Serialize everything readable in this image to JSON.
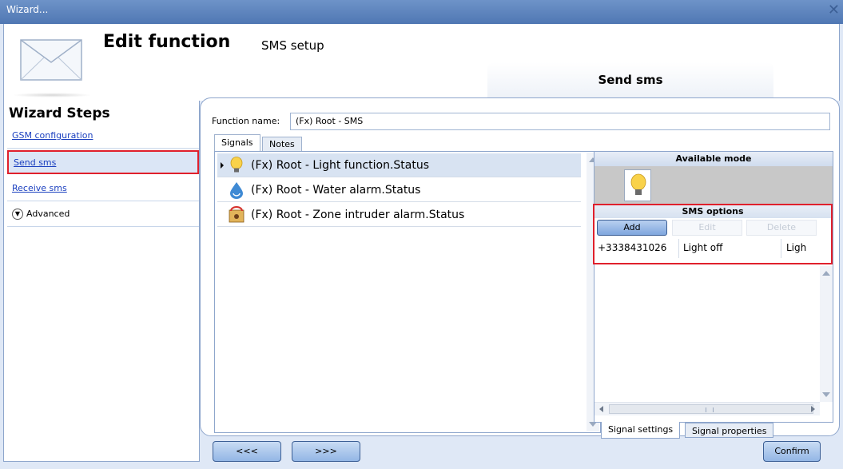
{
  "window": {
    "title": "Wizard...",
    "close_glyph": "✕"
  },
  "header": {
    "title": "Edit function",
    "subtitle": "SMS setup",
    "current_step": "Send sms",
    "icon": "envelope-icon"
  },
  "sidebar": {
    "title": "Wizard Steps",
    "steps": [
      {
        "label": "GSM configuration"
      },
      {
        "label": "Send sms",
        "selected": true
      },
      {
        "label": "Receive sms"
      }
    ],
    "advanced_label": "Advanced",
    "highlight_color": "#e0202c"
  },
  "form": {
    "function_name_label": "Function name:",
    "function_name_value": "(Fx) Root - SMS"
  },
  "tabs": [
    {
      "label": "Signals",
      "active": true
    },
    {
      "label": "Notes",
      "active": false
    }
  ],
  "signals": [
    {
      "label": "(Fx) Root - Light function.Status",
      "icon": "light-bulb-icon",
      "selected": true
    },
    {
      "label": "(Fx) Root - Water alarm.Status",
      "icon": "water-drop-icon",
      "selected": false
    },
    {
      "label": "(Fx) Root - Zone intruder alarm.Status",
      "icon": "intruder-alarm-icon",
      "selected": false
    }
  ],
  "right_panel": {
    "available_mode_title": "Available mode",
    "available_mode_icon": "light-bulb-icon",
    "sms_options_title": "SMS options",
    "buttons": {
      "add": "Add",
      "edit": "Edit",
      "delete": "Delete"
    },
    "rows": [
      {
        "phone": "+3338431026",
        "message": "Light off",
        "extra": "Ligh"
      }
    ],
    "bottom_tabs": [
      {
        "label": "Signal settings",
        "active": true
      },
      {
        "label": "Signal properties",
        "active": false
      }
    ]
  },
  "footer": {
    "prev": "<<<",
    "next": ">>>",
    "confirm": "Confirm"
  }
}
